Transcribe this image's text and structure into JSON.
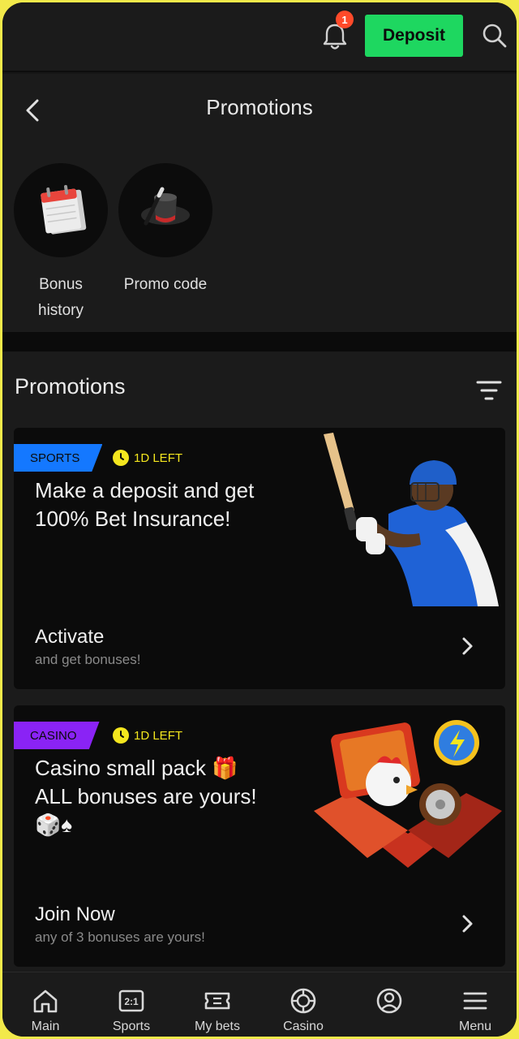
{
  "topbar": {
    "notification_count": "1",
    "deposit_label": "Deposit"
  },
  "header": {
    "title": "Promotions",
    "shortcuts": [
      {
        "label_line1": "Bonus",
        "label_line2": "history",
        "icon": "calendar-icon"
      },
      {
        "label_line1": "Promo code",
        "label_line2": "",
        "icon": "magic-hat-icon"
      }
    ]
  },
  "promotions": {
    "title": "Promotions",
    "cards": [
      {
        "tag": "SPORTS",
        "timer": "1D LEFT",
        "title": "Make a deposit and get 100% Bet Insurance!",
        "cta": "Activate",
        "cta_sub": "and get bonuses!",
        "art": "cricket-player-image"
      },
      {
        "tag": "CASINO",
        "timer": "1D LEFT",
        "title": "Casino small pack 🎁 ALL bonuses are yours! 🎲♠",
        "cta": "Join Now",
        "cta_sub": "any of 3 bonuses are yours!",
        "art": "casino-giftbox-image"
      }
    ]
  },
  "bottom_nav": [
    {
      "label": "Main",
      "icon": "home-icon"
    },
    {
      "label": "Sports",
      "icon": "scoreboard-icon"
    },
    {
      "label": "My bets",
      "icon": "ticket-icon"
    },
    {
      "label": "Casino",
      "icon": "roulette-chip-icon"
    },
    {
      "label": "",
      "icon": "profile-icon"
    },
    {
      "label": "Menu",
      "icon": "hamburger-icon"
    }
  ],
  "colors": {
    "accent_green": "#1ed760",
    "sports_tag": "#1478ff",
    "casino_tag": "#8a23f5",
    "timer_yellow": "#f4e61e",
    "badge_red": "#ff4a2a"
  }
}
